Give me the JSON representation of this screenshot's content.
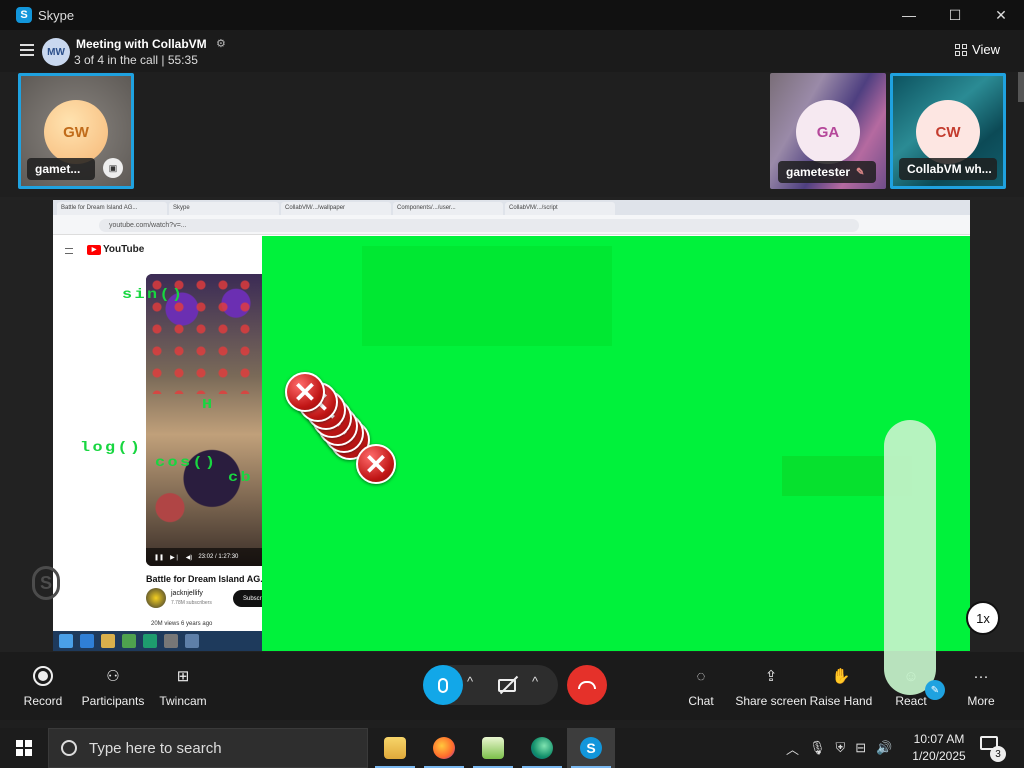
{
  "window": {
    "app_title": "Skype",
    "app_icon": "skype-icon",
    "controls": {
      "minimize": "—",
      "maximize": "☐",
      "close": "✕"
    }
  },
  "call": {
    "avatar_initials": "MW",
    "title": "Meeting with CollabVM",
    "settings_icon": "⚙",
    "subtitle": "3 of 4 in the call | 55:35",
    "view_label": "View"
  },
  "participants": [
    {
      "initials": "GW",
      "name": "gamet...",
      "active": true,
      "badge_icon": "screen-share-icon"
    },
    {
      "initials": "GA",
      "name": "gametester",
      "active": false,
      "badge_icon": "mic-muted-icon"
    },
    {
      "initials": "CW",
      "name": "CollabVM wh...",
      "active": true
    }
  ],
  "shared_screen": {
    "browser_tabs": [
      "Battle for Dream Island AG...",
      "Skype",
      "CollabVM/.../wallpaper",
      "Components/.../user...",
      "CollabVM/.../script"
    ],
    "url": "youtube.com/watch?v=...",
    "site_name": "YouTube",
    "video_time": "23:02 / 1:27:30",
    "video_title": "Battle for Dream Island AG...",
    "channel_name": "jacknjellify",
    "channel_subs": "7.78M subscribers",
    "subscribe_label": "Subscri",
    "views": "20M views  6 years ago",
    "math_text": [
      "sin()",
      "H",
      "log()",
      "cos()",
      "cb"
    ],
    "error_glyph": "✕",
    "watermark": "S",
    "zoom_level": "1x"
  },
  "controls": {
    "record": "Record",
    "participants": "Participants",
    "twincam": "Twincam",
    "chat": "Chat",
    "share_screen": "Share screen",
    "raise_hand": "Raise Hand",
    "react": "React",
    "more": "More",
    "caret": "^"
  },
  "taskbar": {
    "search_placeholder": "Type here to search",
    "time": "10:07 AM",
    "date": "1/20/2025",
    "notification_count": "3",
    "tray_icons": [
      "chevron-up-icon",
      "microphone-icon",
      "security-alert-icon",
      "network-icon",
      "volume-icon"
    ]
  },
  "colors": {
    "accent": "#1fa2e0",
    "hangup": "#e5312a",
    "shared_green": "#00f23b"
  }
}
